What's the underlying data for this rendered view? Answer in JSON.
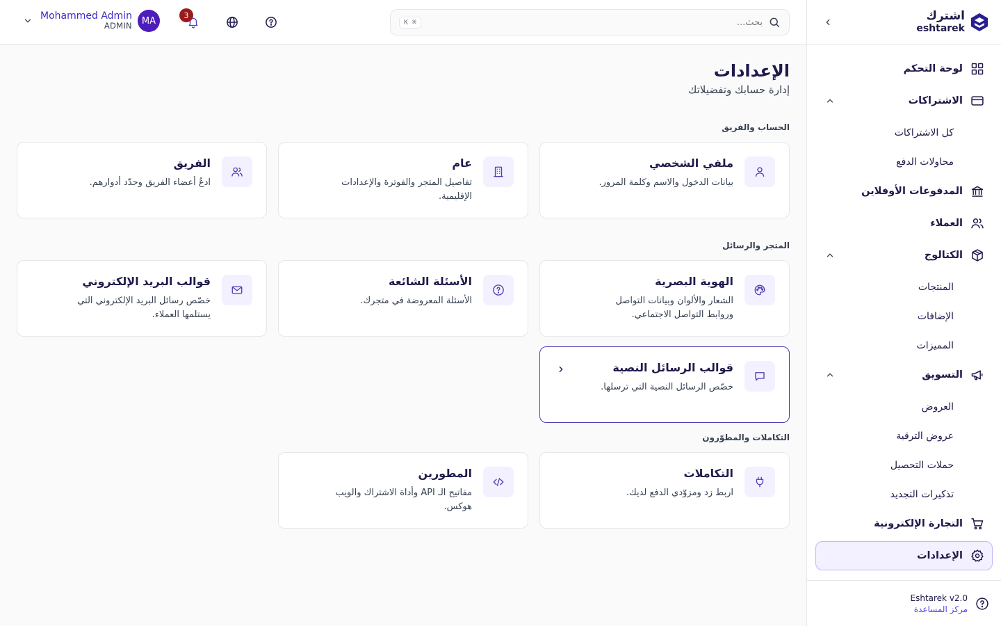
{
  "brand": {
    "name_ar": "اشترك",
    "name_en": "eshtarek"
  },
  "search": {
    "placeholder": "بحث...",
    "shortcut": "⌘ K"
  },
  "notifications": {
    "count": "3"
  },
  "user": {
    "name": "Mohammed Admin",
    "role": "ADMIN",
    "initials": "MA"
  },
  "sidebar": {
    "items": [
      {
        "label": "لوحة التحكم",
        "icon": "dashboard-icon"
      },
      {
        "label": "الاشتراكات",
        "icon": "card-icon",
        "children": [
          "كل الاشتراكات",
          "محاولات الدفع"
        ]
      },
      {
        "label": "المدفوعات الأوفلاين",
        "icon": "bank-icon"
      },
      {
        "label": "العملاء",
        "icon": "users-icon"
      },
      {
        "label": "الكتالوج",
        "icon": "box-icon",
        "children": [
          "المنتجات",
          "الإضافات",
          "المميزات"
        ]
      },
      {
        "label": "التسويق",
        "icon": "megaphone-icon",
        "children": [
          "العروض",
          "عروض الترقية",
          "حملات التحصيل",
          "تذكيرات التجديد"
        ]
      },
      {
        "label": "التجارة الإلكترونية",
        "icon": "cart-icon"
      },
      {
        "label": "الإعدادات",
        "icon": "gear-icon",
        "active": true
      }
    ],
    "footer": {
      "version": "Eshtarek v2.0",
      "help": "مركز المساعدة"
    }
  },
  "page": {
    "title": "الإعدادات",
    "subtitle": "إدارة حسابك وتفضيلاتك",
    "sections": [
      {
        "title": "الحساب والفريق",
        "cards": [
          {
            "title": "ملفي الشخصي",
            "desc": "بيانات الدخول والاسم وكلمة المرور.",
            "icon": "user-icon"
          },
          {
            "title": "عام",
            "desc": "تفاصيل المتجر والفوترة والإعدادات الإقليمية.",
            "icon": "building-icon"
          },
          {
            "title": "الفريق",
            "desc": "ادعُ أعضاء الفريق وحدّد أدوارهم.",
            "icon": "team-icon"
          }
        ]
      },
      {
        "title": "المتجر والرسائل",
        "cards": [
          {
            "title": "الهوية البصرية",
            "desc": "الشعار والألوان وبيانات التواصل وروابط التواصل الاجتماعي.",
            "icon": "palette-icon"
          },
          {
            "title": "الأسئلة الشائعة",
            "desc": "الأسئلة المعروضة في متجرك.",
            "icon": "question-icon"
          },
          {
            "title": "قوالب البريد الإلكتروني",
            "desc": "خصّص رسائل البريد الإلكتروني التي يستلمها العملاء.",
            "icon": "mail-icon"
          },
          {
            "title": "قوالب الرسائل النصية",
            "desc": "خصّص الرسائل النصية التي ترسلها.",
            "icon": "message-icon",
            "selected": true
          }
        ]
      },
      {
        "title": "التكاملات والمطوّرون",
        "cards": [
          {
            "title": "التكاملات",
            "desc": "اربط زد ومزوّدي الدفع لديك.",
            "icon": "plug-icon"
          },
          {
            "title": "المطورين",
            "desc": "مفاتيح الـ API وأداة الاشتراك والويب هوكس.",
            "icon": "code-icon"
          }
        ]
      }
    ]
  },
  "colors": {
    "accent": "#4c3fb3",
    "accent_bg": "#f3f0ff",
    "badge": "#991b1b",
    "avatar": "#4c1dba"
  }
}
